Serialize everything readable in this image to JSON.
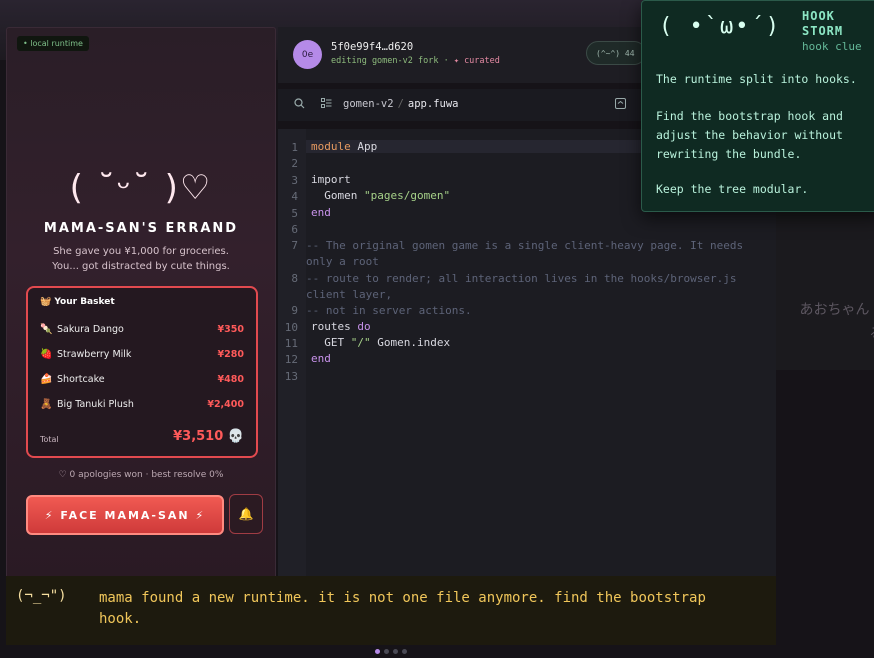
{
  "background": {
    "jp_text": "あおちゃん てる/"
  },
  "phone": {
    "runtime_badge": "• local runtime",
    "kaomoji": "( ˘ᵕ˘ )♡",
    "title": "MAMA-SAN'S ERRAND",
    "subtitle_1": "She gave you ¥1,000 for groceries.",
    "subtitle_2": "You... got distracted by cute things.",
    "basket_title": "🧺 Your Basket",
    "items": [
      {
        "icon": "🍡",
        "name": "Sakura Dango",
        "price": "¥350"
      },
      {
        "icon": "🍓",
        "name": "Strawberry Milk",
        "price": "¥280"
      },
      {
        "icon": "🍰",
        "name": "Shortcake",
        "price": "¥480"
      },
      {
        "icon": "🧸",
        "name": "Big Tanuki Plush",
        "price": "¥2,400"
      }
    ],
    "total_label": "Total",
    "total_value": "¥3,510 💀",
    "apologies": "♡ 0 apologies won · best resolve 0%",
    "face_button": "⚡ FACE MAMA-SAN ⚡",
    "bell_icon": "🔔"
  },
  "editor": {
    "avatar": "0e",
    "commit_hash": "5f0e99f4…d620",
    "commit_sub": "editing gomen-v2 fork · ",
    "commit_curated": "✦ curated",
    "status_pill": "(^~^) 44",
    "breadcrumb_repo": "gomen-v2",
    "breadcrumb_sep": "/",
    "breadcrumb_file": "app.fuwa",
    "line_numbers": [
      "1",
      "2",
      "3",
      "4",
      "5",
      "6",
      "7",
      "8",
      "9",
      "10",
      "11",
      "12",
      "13"
    ],
    "code": {
      "l1_kw": "module",
      "l1_rest": " App",
      "l3_kw": "import",
      "l4_ident": "  Gomen ",
      "l4_str": "\"pages/gomen\"",
      "l5_kw": "end",
      "l7_cm": "-- The original gomen game is a single client-heavy page. It needs only a root",
      "l8_cm": "-- route to render; all interaction lives in the hooks/browser.js client layer,",
      "l9_cm": "-- not in server actions.",
      "l10_ident": "routes ",
      "l10_kw": "do",
      "l11_a": "  GET ",
      "l11_str": "\"/\"",
      "l11_b": " Gomen.index",
      "l12_kw": "end"
    }
  },
  "storm": {
    "face": "( •`ω•´)",
    "title_1": "HOOK",
    "title_2": "STORM",
    "clue": "hook clue",
    "p1": "The runtime split into hooks.",
    "p2": "Find the bootstrap hook and adjust the behavior without rewriting the bundle.",
    "p3": "Keep the tree modular."
  },
  "dialog": {
    "face": "(¬_¬\")",
    "text": "mama found a new runtime. it is not one file anymore. find the bootstrap hook."
  },
  "colors": {
    "accent_red": "#e24a4f",
    "accent_purple": "#b58ae8",
    "storm_green": "#0f2a22",
    "dialog_yellow": "#f0c65a"
  }
}
